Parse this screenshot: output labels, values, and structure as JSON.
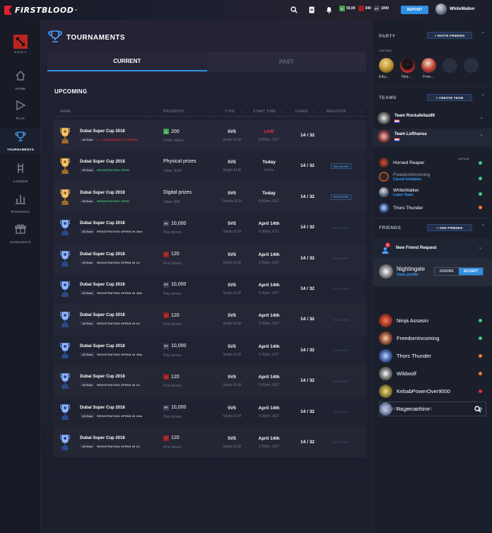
{
  "app": {
    "logo_text": "FIRSTBLOOD",
    "logo_tm": "™"
  },
  "topbar": {
    "icons": [
      "search-icon",
      "document-icon",
      "bell-icon"
    ],
    "wallet": [
      {
        "symbol": "$",
        "value": "50,00",
        "color": "#3fa34d"
      },
      {
        "symbol": "",
        "value": "340",
        "color": "#9a1f1f"
      },
      {
        "symbol": "PT",
        "value": "1000",
        "color": "#3a4155"
      }
    ],
    "deposit_label": "DEPOSIT",
    "username": "WhiteWalker"
  },
  "sidebar": {
    "game_label": "DOTA 2",
    "items": [
      {
        "label": "HOME",
        "icon": "home-icon"
      },
      {
        "label": "PLAY",
        "icon": "play-icon"
      },
      {
        "label": "TOURNAMENTS",
        "icon": "trophy-icon"
      },
      {
        "label": "LADDER",
        "icon": "ladder-icon"
      },
      {
        "label": "RANKINGS",
        "icon": "rankings-icon"
      },
      {
        "label": "GIVEAWAYS",
        "icon": "gift-icon"
      }
    ]
  },
  "main": {
    "title": "TOURNAMENTS",
    "tabs": [
      {
        "label": "CURRENT"
      },
      {
        "label": "PAST"
      }
    ],
    "section": "UPCOMING",
    "columns": [
      "NAME",
      "PRIZEPOOL",
      "TYPE",
      "START TIME",
      "TEAMS",
      "REGISTER"
    ],
    "rows": [
      {
        "name": "Dubai Super Cup 2018",
        "region": "US East",
        "status": "TOURNAMENT STARTED",
        "status_color": "#e0303a",
        "prize": "200",
        "prize_icon": "$",
        "prize_icon_color": "#3fa34d",
        "prize_sub": "Dollar tokens",
        "type": "5V5",
        "type_sub": "Single ELM",
        "start": "LIVE",
        "start_color": "#ff3040",
        "start_sub": "8:00pm, EST",
        "teams": "14 / 32",
        "register": "",
        "trophy": "gold"
      },
      {
        "name": "Dubai Super Cup 2018",
        "region": "US East",
        "status": "REGISTRATION OPEN",
        "status_color": "#3fd07a",
        "prize": "Physical prizes",
        "prize_icon": "",
        "prize_icon_color": "",
        "prize_sub": "Value: $150",
        "type": "5V5",
        "type_sub": "Single ELM",
        "start": "Today",
        "start_color": "#ffffff",
        "start_sub": "41min",
        "teams": "14 / 32",
        "register": "REGISTER",
        "trophy": "gold"
      },
      {
        "name": "Dubai Super Cup 2018",
        "region": "US East",
        "status": "REGISTRATION OPEN",
        "status_color": "#3fd07a",
        "prize": "Digital prizes",
        "prize_icon": "",
        "prize_icon_color": "",
        "prize_sub": "Value: $80",
        "type": "5V5",
        "type_sub": "Double ELM",
        "start": "Today",
        "start_color": "#ffffff",
        "start_sub": "8:00pm, EST",
        "teams": "14 / 32",
        "register": "REGISTER",
        "trophy": "gold"
      },
      {
        "name": "Dubai Super Cup 2018",
        "region": "US East",
        "status": "REGISTRATION OPENS IN 45m",
        "status_color": "#d0d0d0",
        "prize": "10,000",
        "prize_icon": "PT",
        "prize_icon_color": "#3a4155",
        "prize_sub": "Play tokens",
        "type": "5V5",
        "type_sub": "Single ELM",
        "start": "April 14th",
        "start_color": "#ffffff",
        "start_sub": "9:30pm, EST",
        "teams": "14 / 32",
        "register": "REGISTER",
        "trophy": "blue"
      },
      {
        "name": "Dubai Super Cup 2018",
        "region": "US East",
        "status": "REGISTRATION OPENS IN 2h",
        "status_color": "#d0d0d0",
        "prize": "120",
        "prize_icon": "!",
        "prize_icon_color": "#9a1f1f",
        "prize_sub": "First tokens",
        "type": "5V5",
        "type_sub": "Single ELM",
        "start": "April 14th",
        "start_color": "#ffffff",
        "start_sub": "9:30pm, EST",
        "teams": "14 / 32",
        "register": "REGISTER",
        "trophy": "blue"
      },
      {
        "name": "Dubai Super Cup 2018",
        "region": "US East",
        "status": "REGISTRATION OPENS IN 45m",
        "status_color": "#d0d0d0",
        "prize": "10,000",
        "prize_icon": "PT",
        "prize_icon_color": "#3a4155",
        "prize_sub": "Play tokens",
        "type": "5V5",
        "type_sub": "Single ELM",
        "start": "April 14th",
        "start_color": "#ffffff",
        "start_sub": "9:30pm, EST",
        "teams": "14 / 32",
        "register": "REGISTER",
        "trophy": "blue"
      },
      {
        "name": "Dubai Super Cup 2018",
        "region": "US East",
        "status": "REGISTRATION OPENS IN 2h",
        "status_color": "#d0d0d0",
        "prize": "120",
        "prize_icon": "!",
        "prize_icon_color": "#9a1f1f",
        "prize_sub": "First tokens",
        "type": "5V5",
        "type_sub": "Single ELM",
        "start": "April 14th",
        "start_color": "#ffffff",
        "start_sub": "9:30pm, EST",
        "teams": "14 / 32",
        "register": "REGISTER",
        "trophy": "blue"
      },
      {
        "name": "Dubai Super Cup 2018",
        "region": "US East",
        "status": "REGISTRATION OPENS IN 45m",
        "status_color": "#d0d0d0",
        "prize": "10,000",
        "prize_icon": "PT",
        "prize_icon_color": "#3a4155",
        "prize_sub": "Play tokens",
        "type": "5V5",
        "type_sub": "Single ELM",
        "start": "April 14th",
        "start_color": "#ffffff",
        "start_sub": "9:30pm, EST",
        "teams": "14 / 32",
        "register": "REGISTER",
        "trophy": "blue"
      },
      {
        "name": "Dubai Super Cup 2018",
        "region": "US East",
        "status": "REGISTRATION OPENS IN 2h",
        "status_color": "#d0d0d0",
        "prize": "120",
        "prize_icon": "!",
        "prize_icon_color": "#9a1f1f",
        "prize_sub": "First tokens",
        "type": "5V5",
        "type_sub": "Single ELM",
        "start": "April 14th",
        "start_color": "#ffffff",
        "start_sub": "9:30pm, EST",
        "teams": "14 / 32",
        "register": "REGISTER",
        "trophy": "blue"
      },
      {
        "name": "Dubai Super Cup 2018",
        "region": "US East",
        "status": "REGISTRATION OPENS IN 45m",
        "status_color": "#d0d0d0",
        "prize": "10,000",
        "prize_icon": "PT",
        "prize_icon_color": "#3a4155",
        "prize_sub": "Play tokens",
        "type": "5V5",
        "type_sub": "Single ELM",
        "start": "April 14th",
        "start_color": "#ffffff",
        "start_sub": "9:30pm, EST",
        "teams": "14 / 32",
        "register": "REGISTER",
        "trophy": "blue"
      },
      {
        "name": "Dubai Super Cup 2018",
        "region": "US East",
        "status": "REGISTRATION OPENS IN 2h",
        "status_color": "#d0d0d0",
        "prize": "120",
        "prize_icon": "!",
        "prize_icon_color": "#9a1f1f",
        "prize_sub": "First tokens",
        "type": "5V5",
        "type_sub": "Single ELM",
        "start": "April 14th",
        "start_color": "#ffffff",
        "start_sub": "9:30pm, EST",
        "teams": "14 / 32",
        "register": "REGISTER",
        "trophy": "blue"
      }
    ]
  },
  "party": {
    "title": "PARTY",
    "invite_label": "+ INVITE FRIENDS",
    "captain_label": "CAPTAIN",
    "members": [
      "Elky...",
      "Ninj...",
      "Free..."
    ]
  },
  "teams": {
    "title": "TEAMS",
    "create_label": "+ CREATE TEAM",
    "list": [
      "Team Rockafellas89",
      "Team Lufthansa"
    ],
    "captain_label": "CAPTAIN",
    "members": [
      {
        "name": "Horned Reaper",
        "sub": "",
        "status": "#3fd07a"
      },
      {
        "name": "FreedomIncoming",
        "sub": "Cancel invitation",
        "status": "#3fd07a"
      },
      {
        "name": "WhiteWalker",
        "sub": "Leave Team",
        "status": "#3fd07a"
      },
      {
        "name": "Thors Thunder",
        "sub": "",
        "status": "#ff7a30"
      }
    ]
  },
  "friends": {
    "title": "FRIENDS",
    "add_label": "+ ADD FRIENDS",
    "request_title": "New Friend Request",
    "request_count": "1",
    "requester": "Nightingale",
    "view_profile": "View profile",
    "ignore_label": "IGNORE",
    "accept_label": "ACCEPT",
    "list": [
      {
        "name": "Ninja Assasin",
        "status": "#3fd07a"
      },
      {
        "name": "FreedomIncoming",
        "status": "#3fd07a"
      },
      {
        "name": "Thors Thunder",
        "status": "#ff7a30"
      },
      {
        "name": "Wildwolf",
        "status": "#ff7a30"
      },
      {
        "name": "KebabPowerOver9000",
        "status": "#e0303a"
      },
      {
        "name": "Ragemachine",
        "status": "#7d8598"
      }
    ],
    "search_placeholder": "Search amongst friends"
  }
}
